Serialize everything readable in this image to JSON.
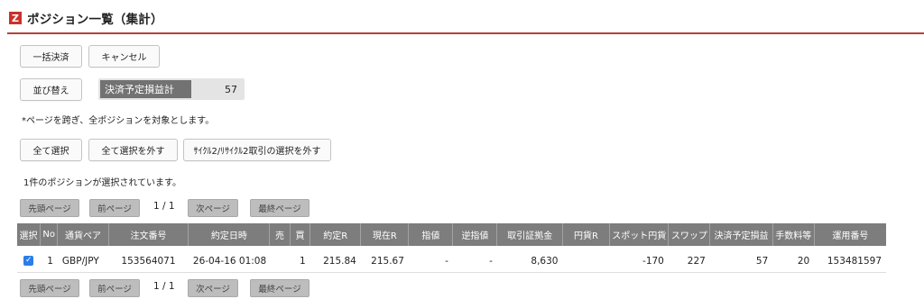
{
  "header": {
    "logo_letter": "Z",
    "title": "ポジション一覧（集計）"
  },
  "toolbar": {
    "bulk_settle": "一括決済",
    "cancel": "キャンセル",
    "sort": "並び替え"
  },
  "pl_summary": {
    "label": "決済予定損益計",
    "value": "57"
  },
  "notice": "*ページを跨ぎ、全ポジションを対象とします。",
  "selection": {
    "select_all": "全て選択",
    "deselect_all": "全て選択を外す",
    "deselect_cycle": "ｻｲｸﾙ2/ﾘｻｲｸﾙ2取引の選択を外す",
    "selected_status": "1件のポジションが選択されています。"
  },
  "pager": {
    "first": "先頭ページ",
    "prev": "前ページ",
    "current": "1",
    "separator": "/",
    "total": "1",
    "next": "次ページ",
    "last": "最終ページ"
  },
  "table": {
    "headers": [
      "選択",
      "No",
      "通貨ペア",
      "注文番号",
      "約定日時",
      "売",
      "買",
      "約定R",
      "現在R",
      "指値",
      "逆指値",
      "取引証拠金",
      "円貨R",
      "スポット円貨",
      "スワップ",
      "決済予定損益",
      "手数料等",
      "運用番号"
    ],
    "rows": [
      {
        "selected": true,
        "no": "1",
        "pair": "GBP/JPY",
        "order_no": "153564071",
        "datetime": "26-04-16 01:08",
        "sell": "",
        "buy": "1",
        "exec_rate": "215.84",
        "current_rate": "215.67",
        "limit": "-",
        "stop": "-",
        "margin": "8,630",
        "yen_rate": "",
        "spot_yen": "-170",
        "swap": "227",
        "pl": "57",
        "fee": "20",
        "op_no": "153481597"
      }
    ]
  },
  "colors": {
    "accent": "#c8322a",
    "header_bg": "#7d7d7d",
    "negative": "#c53b2f",
    "checkbox": "#2b7de9"
  }
}
